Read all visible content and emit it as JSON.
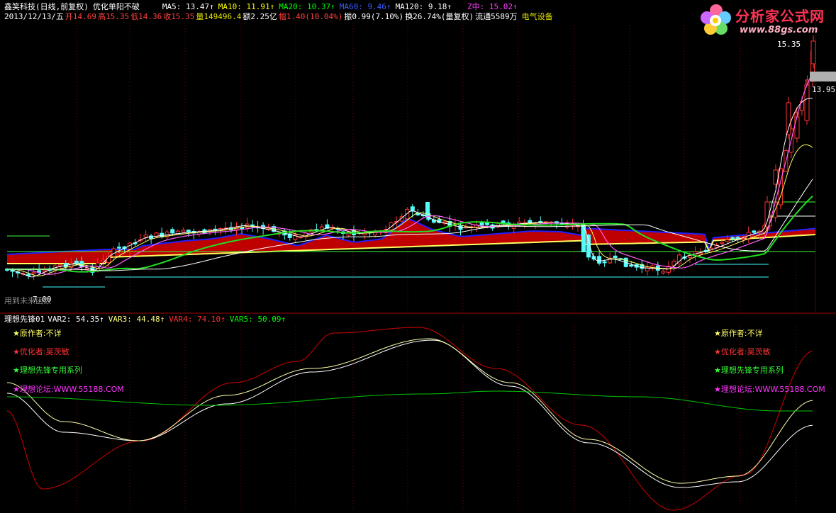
{
  "header": {
    "stock_title": "鑫笑科技(日线,前复权)",
    "formula_name": "优化单阳不破",
    "ma5": "MA5: 13.47↑",
    "ma10": "MA10: 11.91↑",
    "ma20": "MA20: 10.37↑",
    "ma60": "MA60: 9.46↑",
    "ma120": "MA120: 9.18↑",
    "zmid": "Z中: 15.02↑",
    "date": "2013/12/13/五",
    "open": "开14.69",
    "high": "高15.35",
    "low": "低14.36",
    "close": "收15.35",
    "volume": "量149496.4",
    "amount": "额2.25亿",
    "change": "幅1.40(10.04%)",
    "amplitude": "振0.99(7.10%)",
    "turnover": "换26.74%(量复权)",
    "float": "流通5589万",
    "sector": "电气设备"
  },
  "logo": {
    "title": "分析家公式网",
    "url": "www.88gs.com"
  },
  "price_labels": {
    "high": "15.35",
    "close": "13.95",
    "low": "7.00"
  },
  "hint_text": "用到未来函数",
  "indicator": {
    "name": "理想先锋01",
    "var2": "VAR2: 54.35↑",
    "var3": "VAR3: 44.48↑",
    "var4": "VAR4: 74.10↑",
    "var5": "VAR5: 50.09↑",
    "legend": [
      {
        "text": "★原作者:不详",
        "color": "#ffff66"
      },
      {
        "text": "★优化者:吴茨敏",
        "color": "#ff3333"
      },
      {
        "text": "★理想先锋专用系列",
        "color": "#33ff33"
      },
      {
        "text": "★理想论坛:WWW.55188.COM",
        "color": "#ff33ff"
      }
    ]
  },
  "colors": {
    "up": "#ff3232",
    "down": "#54fcfc",
    "ma5": "#ffffff",
    "ma10": "#ffff00",
    "ma20": "#ff80ff",
    "ma60": "#00e600",
    "band": "#c80000",
    "var_red": "#d40000",
    "var_white": "#ffffff",
    "var_yellow": "#ffffaa",
    "var_green": "#00c800",
    "grid": "#7a0000"
  },
  "chart_data": [
    {
      "type": "candlestick",
      "title": "鑫笑科技(日线,前复权)",
      "x": [
        "2013/12/13"
      ],
      "close": [
        15.35
      ],
      "high": [
        15.35
      ],
      "low": [
        14.36
      ],
      "open": [
        14.69
      ],
      "labeled_levels": [
        15.35,
        13.95,
        7.0
      ],
      "moving_averages": [
        {
          "name": "MA5",
          "last": 13.47
        },
        {
          "name": "MA10",
          "last": 11.91
        },
        {
          "name": "MA20",
          "last": 10.37
        },
        {
          "name": "MA60",
          "last": 9.46
        },
        {
          "name": "MA120",
          "last": 9.18
        },
        {
          "name": "Z中",
          "last": 15.02
        }
      ]
    },
    {
      "type": "line",
      "title": "理想先锋01",
      "series": [
        {
          "name": "VAR2",
          "last": 54.35
        },
        {
          "name": "VAR3",
          "last": 44.48
        },
        {
          "name": "VAR4",
          "last": 74.1
        },
        {
          "name": "VAR5",
          "last": 50.09
        }
      ]
    }
  ]
}
